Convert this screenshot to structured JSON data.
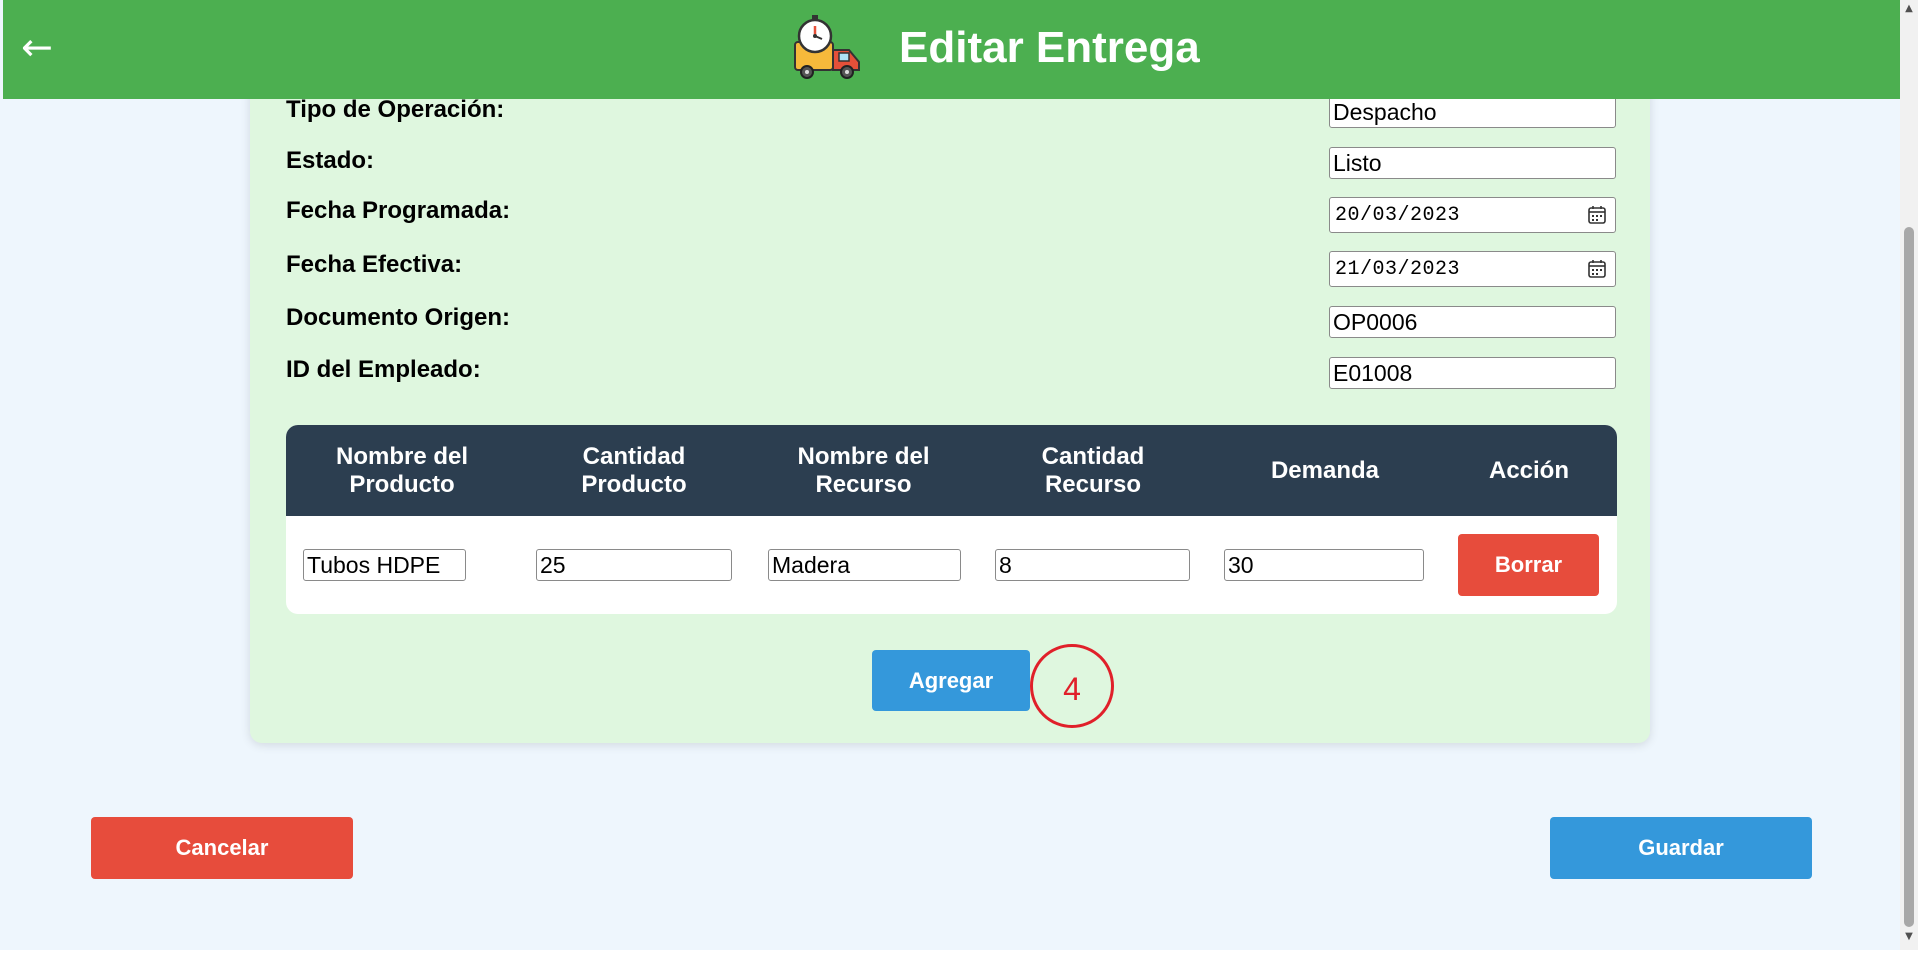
{
  "header": {
    "back_label": "←",
    "title": "Editar Entrega",
    "icon": "delivery-truck-clock-icon",
    "background": "#4caf50"
  },
  "form": {
    "fields": [
      {
        "label": "Tipo de Operación:",
        "value": "Despacho"
      },
      {
        "label": "Estado:",
        "value": "Listo"
      },
      {
        "label": "Fecha Programada:",
        "value": "20/03/2023"
      },
      {
        "label": "Fecha Efectiva:",
        "value": "21/03/2023"
      },
      {
        "label": "Documento Origen:",
        "value": "OP0006"
      },
      {
        "label": "ID del Empleado:",
        "value": "E01008"
      }
    ]
  },
  "table": {
    "headers": [
      "Nombre del\nProducto",
      "Cantidad\nProducto",
      "Nombre del\nRecurso",
      "Cantidad\nRecurso",
      "Demanda",
      "Acción"
    ],
    "rows": [
      {
        "producto": "Tubos HDPE",
        "cantidad_producto": "25",
        "recurso": "Madera",
        "cantidad_recurso": "8",
        "demanda": "30",
        "action_label": "Borrar"
      }
    ],
    "header_color": "#2c3e50"
  },
  "buttons": {
    "add": "Agregar",
    "cancel": "Cancelar",
    "save": "Guardar"
  },
  "annotation": {
    "label": "4",
    "color": "#e0202a"
  },
  "colors": {
    "danger": "#e74c3c",
    "primary": "#3498db",
    "card_background": "#dff7df",
    "page_background": "#eef6fd"
  }
}
